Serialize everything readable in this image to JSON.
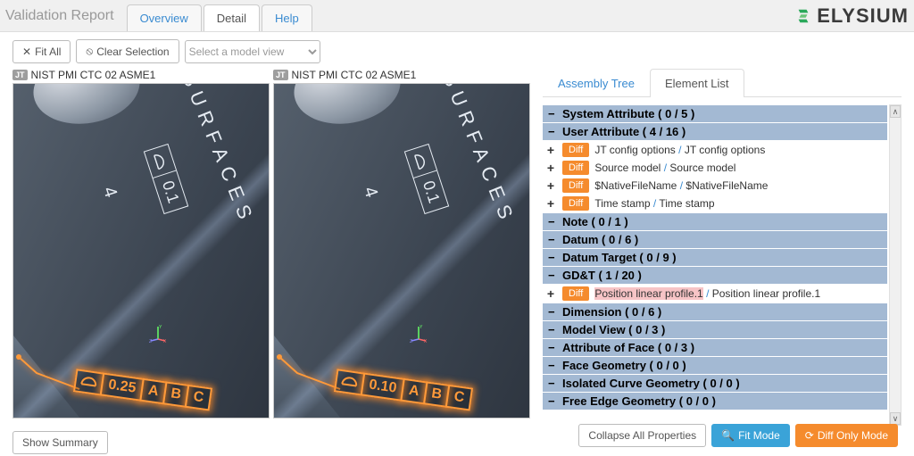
{
  "app_title": "Validation Report",
  "logo_text": "ELYSIUM",
  "top_tabs": {
    "overview": "Overview",
    "detail": "Detail",
    "help": "Help"
  },
  "toolbar": {
    "fit_all": "Fit All",
    "clear_selection": "Clear Selection",
    "model_view_placeholder": "Select a model view"
  },
  "viewer_badge": "JT",
  "viewer_model_name": "NIST PMI CTC 02 ASME1",
  "viewer_a": {
    "surf_text": "SURFACES",
    "four": "4",
    "fcf_top_val": "0.1",
    "fcf_val": "0.25",
    "datums": [
      "A",
      "B",
      "C"
    ]
  },
  "viewer_b": {
    "surf_text": "SURFACES",
    "four": "4",
    "fcf_top_val": "0.1",
    "fcf_val": "0.10",
    "datums": [
      "A",
      "B",
      "C"
    ]
  },
  "panel_tabs": {
    "assembly_tree": "Assembly Tree",
    "element_list": "Element List"
  },
  "diff_tag": "Diff",
  "sections": {
    "system_attr": "System Attribute ( 0 / 5 )",
    "user_attr": "User Attribute ( 4 / 16 )",
    "user_attr_items": [
      {
        "a": "JT config options",
        "b": "JT config options"
      },
      {
        "a": "Source model",
        "b": "Source model"
      },
      {
        "a": "$NativeFileName",
        "b": "$NativeFileName"
      },
      {
        "a": "Time stamp",
        "b": "Time stamp"
      }
    ],
    "note": "Note ( 0 / 1 )",
    "datum": "Datum ( 0 / 6 )",
    "datum_target": "Datum Target ( 0 / 9 )",
    "gdt": "GD&T ( 1 / 20 )",
    "gdt_items": [
      {
        "a": "Position linear profile.1",
        "b": "Position linear profile.1",
        "a_highlight": true
      }
    ],
    "dimension": "Dimension ( 0 / 6 )",
    "model_view": "Model View ( 0 / 3 )",
    "attr_face": "Attribute of Face ( 0 / 3 )",
    "face_geom": "Face Geometry ( 0 / 0 )",
    "iso_curve": "Isolated Curve Geometry ( 0 / 0 )",
    "free_edge": "Free Edge Geometry ( 0 / 0 )"
  },
  "show_summary": "Show Summary",
  "footer": {
    "collapse_all": "Collapse All Properties",
    "fit_mode": "Fit Mode",
    "diff_only": "Diff Only Mode"
  },
  "icons": {
    "fit": "✕",
    "clear": "⦸",
    "mag": "🔍",
    "refresh": "⟳"
  }
}
